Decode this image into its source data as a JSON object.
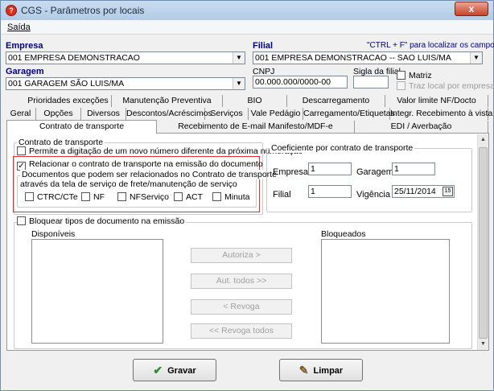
{
  "window": {
    "title": "CGS - Parâmetros por locais",
    "close_label": "x",
    "icon_glyph": "?"
  },
  "menu": {
    "items": [
      {
        "label": "Saída"
      }
    ]
  },
  "header": {
    "empresa_label": "Empresa",
    "empresa_value": "001 EMPRESA DEMONSTRACAO",
    "filial_label": "Filial",
    "filial_value": "001 EMPRESA DEMONSTRACAO -- SAO LUIS/MA",
    "hint": "\"CTRL + F\" para localizar os campos",
    "garagem_label": "Garagem",
    "garagem_value": "001 GARAGEM SÃO LUIS/MA",
    "cnpj_label": "CNPJ",
    "cnpj_value": "00.000.000/0000-00",
    "sigla_label": "Sigla da filial",
    "sigla_value": "",
    "matriz_label": "Matriz",
    "traz_local_label": "Traz local por empresa"
  },
  "tabs": {
    "row1": [
      "Prioridades exceções",
      "Manutenção Preventiva",
      "BIO",
      "Descarregamento",
      "Valor limite NF/Docto"
    ],
    "row2": [
      "Geral",
      "Opções",
      "Diversos",
      "Descontos/Acréscimos",
      "Serviços",
      "Vale Pedágio",
      "Carregamento/Etiquetas",
      "Integr. Recebimento à vista"
    ],
    "row3": [
      "Contrato de transporte",
      "Recebimento de E-mail Manifesto/MDF-e",
      "EDI / Averbação"
    ]
  },
  "contrato": {
    "group_title": "Contrato de transporte",
    "permite_label": "Permite a digitação de um novo número diferente da próxima numeração",
    "relacionar_label": "Relacionar o contrato de transporte na emissão do documento",
    "docs_group_title": "Documentos que podem ser relacionados no Contrato de transporte",
    "docs_subtitle": "através da tela de serviço de frete/manutenção de serviço",
    "doc_types": [
      "CTRC/CTe",
      "NF",
      "NFServiço",
      "ACT",
      "Minuta"
    ]
  },
  "coeficiente": {
    "group_title": "Coeficiente por contrato de transporte",
    "empresa_label": "Empresa",
    "empresa_value": "1",
    "garagem_label": "Garagem",
    "garagem_value": "1",
    "filial_label": "Filial",
    "filial_value": "1",
    "vigencia_label": "Vigência",
    "vigencia_value": "25/11/2014",
    "calendar_glyph": "15"
  },
  "bloquear": {
    "group_title": "Bloquear tipos de documento na emissão",
    "disponiveis_label": "Disponíveis",
    "bloqueados_label": "Bloqueados",
    "buttons": [
      "Autoriza >",
      "Aut. todos >>",
      "< Revoga",
      "<< Revoga todos"
    ]
  },
  "footer": {
    "gravar_label": "Gravar",
    "limpar_label": "Limpar"
  },
  "colors": {
    "label_blue": "#000080",
    "highlight_red": "#e0312b"
  }
}
